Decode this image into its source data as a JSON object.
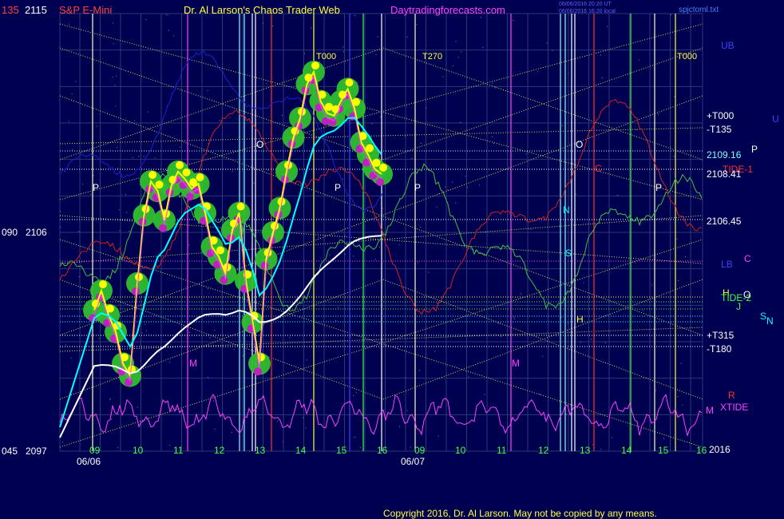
{
  "header": {
    "symbol": "S&P E-Mini",
    "author": "Dr. Al Larson's Chaos Trader Web",
    "website": "Daytradingforecasts.com",
    "timestamp_1": "06/06/2016 20:20 UT",
    "timestamp_2": "06/06/2016 16:20 local",
    "filename": "spjctoml.txt"
  },
  "left_axis": {
    "top_left": "135",
    "top_price": "2115",
    "mid_left": "090",
    "mid_price": "2106",
    "bottom_left": "045",
    "bottom_price": "2097"
  },
  "right_labels": {
    "ub": "UB",
    "u": "U",
    "t000": "+T000",
    "t135": "-T135",
    "p": "P",
    "price_1": "2109.16",
    "price_2": "2108.41",
    "tide_1": "TIDE-1",
    "price_3": "2106.45",
    "lb": "LB",
    "c": "C",
    "h": "H",
    "tide_2": "TIDE-2",
    "o": "O",
    "j": "J",
    "s": "S",
    "n": "N",
    "t315": "+T315",
    "t180": "-T180",
    "r": "R",
    "xtide": "XTIDE",
    "m": "M",
    "price_4": "2016"
  },
  "x_axis": {
    "hours": [
      "09",
      "10",
      "11",
      "12",
      "13",
      "14",
      "15",
      "16",
      "09",
      "10",
      "11",
      "12",
      "13",
      "14",
      "15",
      "16"
    ],
    "dates": [
      "06/06",
      "06/07"
    ]
  },
  "markers": {
    "t000_a": "T000",
    "t270": "T270",
    "t000_b": "T000",
    "p_labels": [
      "P",
      "P",
      "P",
      "P"
    ],
    "m_labels": [
      "M",
      "M"
    ],
    "o_labels": [
      "O",
      "O"
    ],
    "n_label": "N",
    "s_label": "S",
    "h_label": "H",
    "c_label": "C"
  },
  "copyright": "Copyright 2016, Dr. Al Larson. May not be copied by any means.",
  "chart_data": {
    "type": "line",
    "ylim": [
      2097,
      2115
    ],
    "grid": true,
    "series": [
      {
        "name": "S&P E-Mini",
        "color": "#ffff00",
        "points": [
          [
            "09:00",
            2102.8
          ],
          [
            "09:10",
            2103.6
          ],
          [
            "09:20",
            2102.6
          ],
          [
            "09:30",
            2101.9
          ],
          [
            "09:40",
            2100.6
          ],
          [
            "09:50",
            2100.1
          ],
          [
            "10:00",
            2103.9
          ],
          [
            "10:10",
            2106.7
          ],
          [
            "10:20",
            2108.1
          ],
          [
            "10:30",
            2107.7
          ],
          [
            "10:40",
            2106.5
          ],
          [
            "10:50",
            2107.9
          ],
          [
            "11:00",
            2108.5
          ],
          [
            "11:10",
            2108.2
          ],
          [
            "11:20",
            2107.8
          ],
          [
            "11:30",
            2108.0
          ],
          [
            "11:40",
            2106.8
          ],
          [
            "11:50",
            2105.4
          ],
          [
            "12:00",
            2105.0
          ],
          [
            "12:10",
            2104.3
          ],
          [
            "12:20",
            2106.1
          ],
          [
            "12:30",
            2106.8
          ],
          [
            "12:40",
            2104.0
          ],
          [
            "12:50",
            2102.3
          ],
          [
            "13:00",
            2100.6
          ],
          [
            "13:10",
            2104.9
          ],
          [
            "13:20",
            2106.0
          ],
          [
            "13:30",
            2107.0
          ],
          [
            "13:40",
            2108.5
          ],
          [
            "13:50",
            2109.9
          ],
          [
            "14:00",
            2110.7
          ],
          [
            "14:10",
            2112.1
          ],
          [
            "14:20",
            2112.6
          ],
          [
            "14:30",
            2111.4
          ],
          [
            "14:40",
            2110.9
          ],
          [
            "14:50",
            2110.8
          ],
          [
            "15:00",
            2111.4
          ],
          [
            "15:10",
            2111.9
          ],
          [
            "15:20",
            2111.1
          ],
          [
            "15:30",
            2109.7
          ],
          [
            "15:40",
            2109.2
          ],
          [
            "15:50",
            2108.6
          ],
          [
            "16:00",
            2108.4
          ]
        ]
      },
      {
        "name": "",
        "color": "#00ffff",
        "points": []
      },
      {
        "name": "",
        "color": "#ffffff",
        "points": []
      }
    ]
  }
}
